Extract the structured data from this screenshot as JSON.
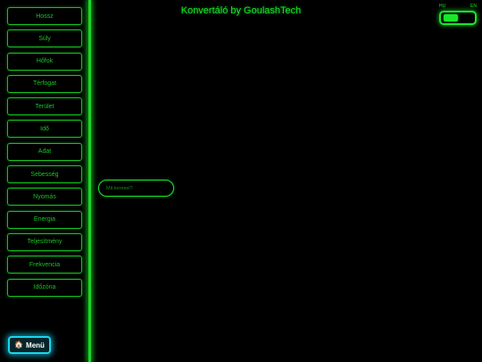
{
  "header": {
    "title": "Konvertáló by GoulashTech"
  },
  "language": {
    "left_label": "HU",
    "right_label": "EN",
    "selected": "HU"
  },
  "sidebar": {
    "items": [
      {
        "label": "Hossz"
      },
      {
        "label": "Súly"
      },
      {
        "label": "Hőfok"
      },
      {
        "label": "Térfogat"
      },
      {
        "label": "Terület"
      },
      {
        "label": "Idő"
      },
      {
        "label": "Adat"
      },
      {
        "label": "Sebesség"
      },
      {
        "label": "Nyomás"
      },
      {
        "label": "Energia"
      },
      {
        "label": "Teljesítmény"
      },
      {
        "label": "Frekvencia"
      },
      {
        "label": "Időzóna"
      }
    ],
    "menu_button": {
      "icon": "home-icon",
      "label": "Menü"
    }
  },
  "search": {
    "placeholder": "Mit keresel?",
    "value": ""
  },
  "colors": {
    "background": "#000000",
    "accent_green": "#18e82b",
    "menu_cyan": "#19d6f0"
  }
}
